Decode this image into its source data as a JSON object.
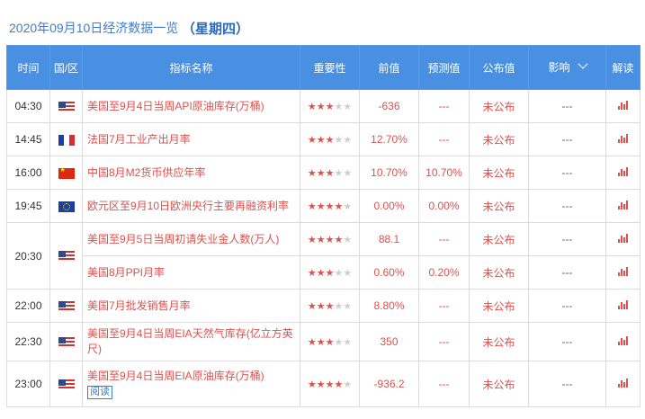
{
  "header": {
    "date_title": "2020年09月10日经济数据一览",
    "weekday": "（星期四）"
  },
  "columns": {
    "time": "时间",
    "country": "国/区",
    "indicator": "指标名称",
    "importance": "重要性",
    "prev": "前值",
    "forecast": "预测值",
    "actual": "公布值",
    "impact": "影响",
    "interpret": "解读"
  },
  "star_glyph": "★",
  "rows": [
    {
      "time": "04:30",
      "flag": "us-flag-icon",
      "indicator": "美国至9月4日当周API原油库存(万桶)",
      "stars": 3,
      "prev": "-636",
      "forecast": "---",
      "actual": "未公布",
      "impact": "---"
    },
    {
      "time": "14:45",
      "flag": "fr-flag-icon",
      "indicator": "法国7月工业产出月率",
      "stars": 3,
      "prev": "12.70%",
      "forecast": "---",
      "actual": "未公布",
      "impact": "---"
    },
    {
      "time": "16:00",
      "flag": "cn-flag-icon",
      "indicator": "中国8月M2货币供应年率",
      "stars": 3,
      "prev": "10.70%",
      "forecast": "10.70%",
      "actual": "未公布",
      "impact": "---"
    },
    {
      "time": "19:45",
      "flag": "eu-flag-icon",
      "indicator": "欧元区至9月10日欧洲央行主要再融资利率",
      "stars": 4,
      "prev": "0.00%",
      "forecast": "0.00%",
      "actual": "未公布",
      "impact": "---"
    },
    {
      "time": "20:30",
      "flag": "us-flag-icon",
      "indicator": "美国至9月5日当周初请失业金人数(万人)",
      "stars": 4,
      "prev": "88.1",
      "forecast": "---",
      "actual": "未公布",
      "impact": "---"
    },
    {
      "time": "",
      "flag": "",
      "indicator": "美国8月PPI月率",
      "stars": 3,
      "prev": "0.60%",
      "forecast": "0.20%",
      "actual": "未公布",
      "impact": "---"
    },
    {
      "time": "22:00",
      "flag": "us-flag-icon",
      "indicator": "美国7月批发销售月率",
      "stars": 3,
      "prev": "8.80%",
      "forecast": "---",
      "actual": "未公布",
      "impact": "---"
    },
    {
      "time": "22:30",
      "flag": "us-flag-icon",
      "indicator": "美国至9月4日当周EIA天然气库存(亿立方英尺)",
      "stars": 3,
      "prev": "350",
      "forecast": "---",
      "actual": "未公布",
      "impact": "---"
    },
    {
      "time": "23:00",
      "flag": "us-flag-icon",
      "indicator": "美国至9月4日当周EIA原油库存(万桶)",
      "stars": 4,
      "prev": "-936.2",
      "forecast": "---",
      "actual": "未公布",
      "impact": "---",
      "read_label": "阅读"
    }
  ]
}
